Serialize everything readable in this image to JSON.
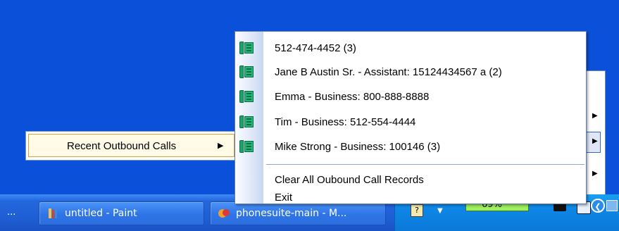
{
  "left_menu": {
    "label": "Recent Outbound Calls"
  },
  "menu": {
    "items": [
      {
        "label": "512-474-4452 (3)",
        "icon": "phone-icon"
      },
      {
        "label": "Jane B Austin Sr. - Assistant: 15124434567 a (2)",
        "icon": "phone-icon"
      },
      {
        "label": "Emma - Business: 800-888-8888",
        "icon": "phone-icon"
      },
      {
        "label": "Tim - Business: 512-554-4444",
        "icon": "phone-icon"
      },
      {
        "label": "Mike Strong - Business: 100146 (3)",
        "icon": "phone-icon"
      }
    ],
    "clear_label": "Clear All Oubound Call Records",
    "exit_label": "Exit"
  },
  "taskbar": {
    "overflow_label": "...",
    "buttons": [
      {
        "label": "untitled - Paint",
        "icon": "paint-icon"
      },
      {
        "label": "phonesuite-main - M...",
        "icon": "app-icon"
      }
    ],
    "tray": {
      "battery_text": "69%"
    }
  },
  "colors": {
    "desktop": "#0b50d8",
    "menu_border": "#5e7db3",
    "highlight_border": "#d8a23c"
  }
}
